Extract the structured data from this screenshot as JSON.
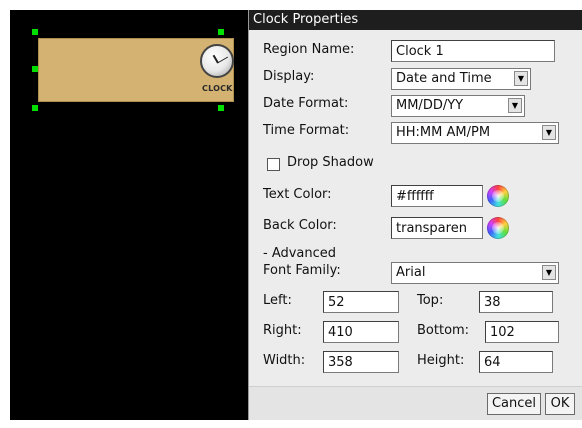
{
  "canvas": {
    "region_icon": "clock-icon",
    "region_icon_label": "CLOCK",
    "region_color": "#d4b271",
    "handle_color": "#00e000"
  },
  "dialog": {
    "title": "Clock Properties",
    "region_name_label": "Region Name:",
    "region_name_value": "Clock 1",
    "display_label": "Display:",
    "display_value": "Date and Time",
    "date_format_label": "Date Format:",
    "date_format_value": "MM/DD/YY",
    "time_format_label": "Time Format:",
    "time_format_value": "HH:MM AM/PM",
    "drop_shadow_label": "Drop Shadow",
    "drop_shadow_checked": false,
    "text_color_label": "Text Color:",
    "text_color_value": "#ffffff",
    "back_color_label": "Back Color:",
    "back_color_value": "transparen",
    "advanced_label": "- Advanced",
    "font_family_label": "Font Family:",
    "font_family_value": "Arial",
    "left_label": "Left:",
    "left_value": "52",
    "top_label": "Top:",
    "top_value": "38",
    "right_label": "Right:",
    "right_value": "410",
    "bottom_label": "Bottom:",
    "bottom_value": "102",
    "width_label": "Width:",
    "width_value": "358",
    "height_label": "Height:",
    "height_value": "64",
    "cancel_label": "Cancel",
    "ok_label": "OK"
  }
}
